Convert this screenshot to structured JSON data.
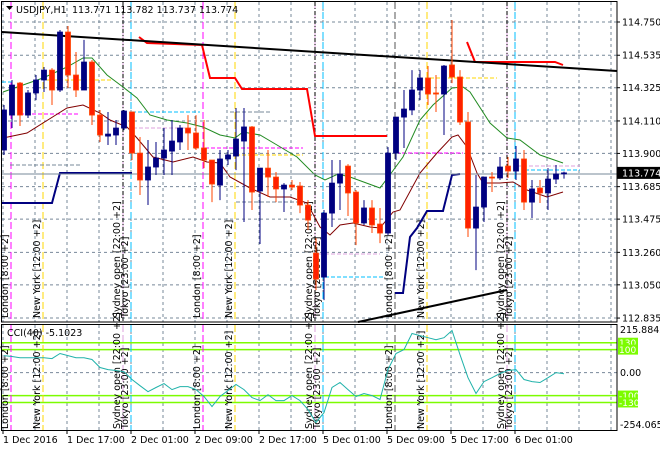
{
  "header": {
    "symbol": "USDJPY,H1",
    "ohlc": "113.771 113.782 113.737 113.774",
    "menu_icon": "triangle-down-icon"
  },
  "colors": {
    "bull": "#000080",
    "bear": "#ff2000",
    "grid": "#778899",
    "ma_fast": "#228b22",
    "ma_slow": "#800000",
    "resistance": "#ff0000",
    "support": "#000080",
    "trendline": "#000000",
    "cci_line": "#20b2aa",
    "cci_level": "#7cfc00",
    "london": "#ff00ff",
    "new_york": "#ffd700",
    "sydney": "#dda0dd",
    "tokyo": "#00bfff"
  },
  "chart_data": [
    {
      "type": "candlestick",
      "title": "USDJPY,H1",
      "price_axis_labels": [
        "114.750",
        "114.535",
        "114.325",
        "114.110",
        "113.900",
        "113.685",
        "113.475",
        "113.260",
        "113.050",
        "112.835"
      ],
      "ylim": [
        112.835,
        114.75
      ],
      "current_price": "113.774",
      "time_labels": [
        "1 Dec 2016",
        "1 Dec 17:00",
        "2 Dec 01:00",
        "2 Dec 09:00",
        "2 Dec 17:00",
        "5 Dec 01:00",
        "5 Dec 09:00",
        "5 Dec 17:00",
        "6 Dec 01:00"
      ],
      "candles_ohlc": [
        [
          113.922,
          114.213,
          113.89,
          114.181
        ],
        [
          114.148,
          114.375,
          114.064,
          114.342
        ],
        [
          114.355,
          114.362,
          114.077,
          114.148
        ],
        [
          114.148,
          114.31,
          114.129,
          114.291
        ],
        [
          114.291,
          114.407,
          114.245,
          114.375
        ],
        [
          114.375,
          114.459,
          114.297,
          114.439
        ],
        [
          114.439,
          114.452,
          114.213,
          114.31
        ],
        [
          114.31,
          114.698,
          114.297,
          114.685
        ],
        [
          114.685,
          114.724,
          114.323,
          114.407
        ],
        [
          114.407,
          114.556,
          114.265,
          114.31
        ],
        [
          114.31,
          114.634,
          114.31,
          114.491
        ],
        [
          114.491,
          114.504,
          114.084,
          114.148
        ],
        [
          114.148,
          114.181,
          113.974,
          114.019
        ],
        [
          114.012,
          114.168,
          113.954,
          114.025
        ],
        [
          114.019,
          114.116,
          113.954,
          114.064
        ],
        [
          114.064,
          114.181,
          114.051,
          114.174
        ],
        [
          114.168,
          114.168,
          113.857,
          113.902
        ],
        [
          113.902,
          114.006,
          113.631,
          113.728
        ],
        [
          113.728,
          113.987,
          113.566,
          113.812
        ],
        [
          113.812,
          113.974,
          113.76,
          113.87
        ],
        [
          113.87,
          114.064,
          113.76,
          113.922
        ],
        [
          113.915,
          114.116,
          113.76,
          113.98
        ],
        [
          113.974,
          114.084,
          113.922,
          114.064
        ],
        [
          114.064,
          114.148,
          113.922,
          114.032
        ],
        [
          114.032,
          114.148,
          113.922,
          113.935
        ],
        [
          113.935,
          114.116,
          113.805,
          113.857
        ],
        [
          113.857,
          113.857,
          113.585,
          113.702
        ],
        [
          113.695,
          113.922,
          113.598,
          113.864
        ],
        [
          113.864,
          113.922,
          113.825,
          113.89
        ],
        [
          113.883,
          114.194,
          113.792,
          113.993
        ],
        [
          113.98,
          114.194,
          113.456,
          114.071
        ],
        [
          114.071,
          114.077,
          113.534,
          113.65
        ],
        [
          113.657,
          113.805,
          113.314,
          113.805
        ],
        [
          113.805,
          113.922,
          113.618,
          113.747
        ],
        [
          113.747,
          113.78,
          113.585,
          113.67
        ],
        [
          113.67,
          113.708,
          113.521,
          113.695
        ],
        [
          113.695,
          113.728,
          113.663,
          113.682
        ],
        [
          113.689,
          113.715,
          113.514,
          113.566
        ],
        [
          113.566,
          113.598,
          113.404,
          113.469
        ],
        [
          113.255,
          113.352,
          113.016,
          113.087
        ],
        [
          113.1,
          113.534,
          112.951,
          113.514
        ],
        [
          113.514,
          113.857,
          113.424,
          113.708
        ],
        [
          113.708,
          113.857,
          113.534,
          113.767
        ],
        [
          113.818,
          113.831,
          113.495,
          113.644
        ],
        [
          113.65,
          113.663,
          113.307,
          113.45
        ],
        [
          113.45,
          113.598,
          113.437,
          113.547
        ],
        [
          113.547,
          113.598,
          113.385,
          113.437
        ],
        [
          113.443,
          113.547,
          113.32,
          113.385
        ],
        [
          113.385,
          113.941,
          113.372,
          113.902
        ],
        [
          113.902,
          114.135,
          113.857,
          114.135
        ],
        [
          114.135,
          114.31,
          113.935,
          114.187
        ],
        [
          114.181,
          114.439,
          114.148,
          114.31
        ],
        [
          114.31,
          114.439,
          114.245,
          114.388
        ],
        [
          114.388,
          114.465,
          114.213,
          114.284
        ],
        [
          114.291,
          114.407,
          114.168,
          114.284
        ],
        [
          114.284,
          114.472,
          114.019,
          114.465
        ],
        [
          114.472,
          114.763,
          114.355,
          114.394
        ],
        [
          114.394,
          114.439,
          114.084,
          114.103
        ],
        [
          114.103,
          114.168,
          113.359,
          113.417
        ],
        [
          113.417,
          113.76,
          113.145,
          113.553
        ],
        [
          113.553,
          113.747,
          113.456,
          113.747
        ],
        [
          113.747,
          113.78,
          113.65,
          113.741
        ],
        [
          113.741,
          113.877,
          113.728,
          113.812
        ],
        [
          113.818,
          113.877,
          113.741,
          113.786
        ],
        [
          113.786,
          113.948,
          113.728,
          113.864
        ],
        [
          113.864,
          113.922,
          113.534,
          113.585
        ],
        [
          113.585,
          113.728,
          113.482,
          113.67
        ],
        [
          113.676,
          113.728,
          113.579,
          113.644
        ],
        [
          113.644,
          113.805,
          113.534,
          113.734
        ],
        [
          113.734,
          113.825,
          113.702,
          113.767
        ],
        [
          113.771,
          113.782,
          113.737,
          113.774
        ]
      ]
    },
    {
      "type": "line",
      "title": "CCI(40)",
      "current_value": "-5.1023",
      "axis_labels": [
        "215.8842",
        "0.00",
        "-254.0655"
      ],
      "ylim": [
        -254.0655,
        215.8842
      ],
      "levels": [
        "130",
        "100",
        "-100",
        "-130"
      ],
      "values": [
        74,
        70,
        65,
        65,
        65,
        65,
        61,
        83,
        74,
        65,
        65,
        57,
        22,
        13,
        9,
        4,
        -30,
        -57,
        -83,
        -65,
        -48,
        -74,
        -61,
        -61,
        -74,
        -104,
        -148,
        -104,
        -78,
        -52,
        -74,
        -109,
        -122,
        -96,
        -122,
        -122,
        -100,
        -122,
        -161,
        -217,
        -174,
        -65,
        -43,
        -74,
        -104,
        -91,
        -100,
        -117,
        13,
        83,
        100,
        170,
        161,
        152,
        143,
        152,
        183,
        78,
        -22,
        -91,
        -39,
        -22,
        -4,
        9,
        13,
        -30,
        -39,
        -43,
        -22,
        0,
        -5.1
      ]
    }
  ],
  "sessions": [
    {
      "label": "London [8:00 +2]",
      "color_key": "london"
    },
    {
      "label": "New York [12:00 +2]",
      "color_key": "new_york"
    },
    {
      "label": "Sydney open [22:00 +2]",
      "color_key": "sydney"
    },
    {
      "label": "Tokyo [23:00 +2]",
      "color_key": "tokyo"
    }
  ]
}
